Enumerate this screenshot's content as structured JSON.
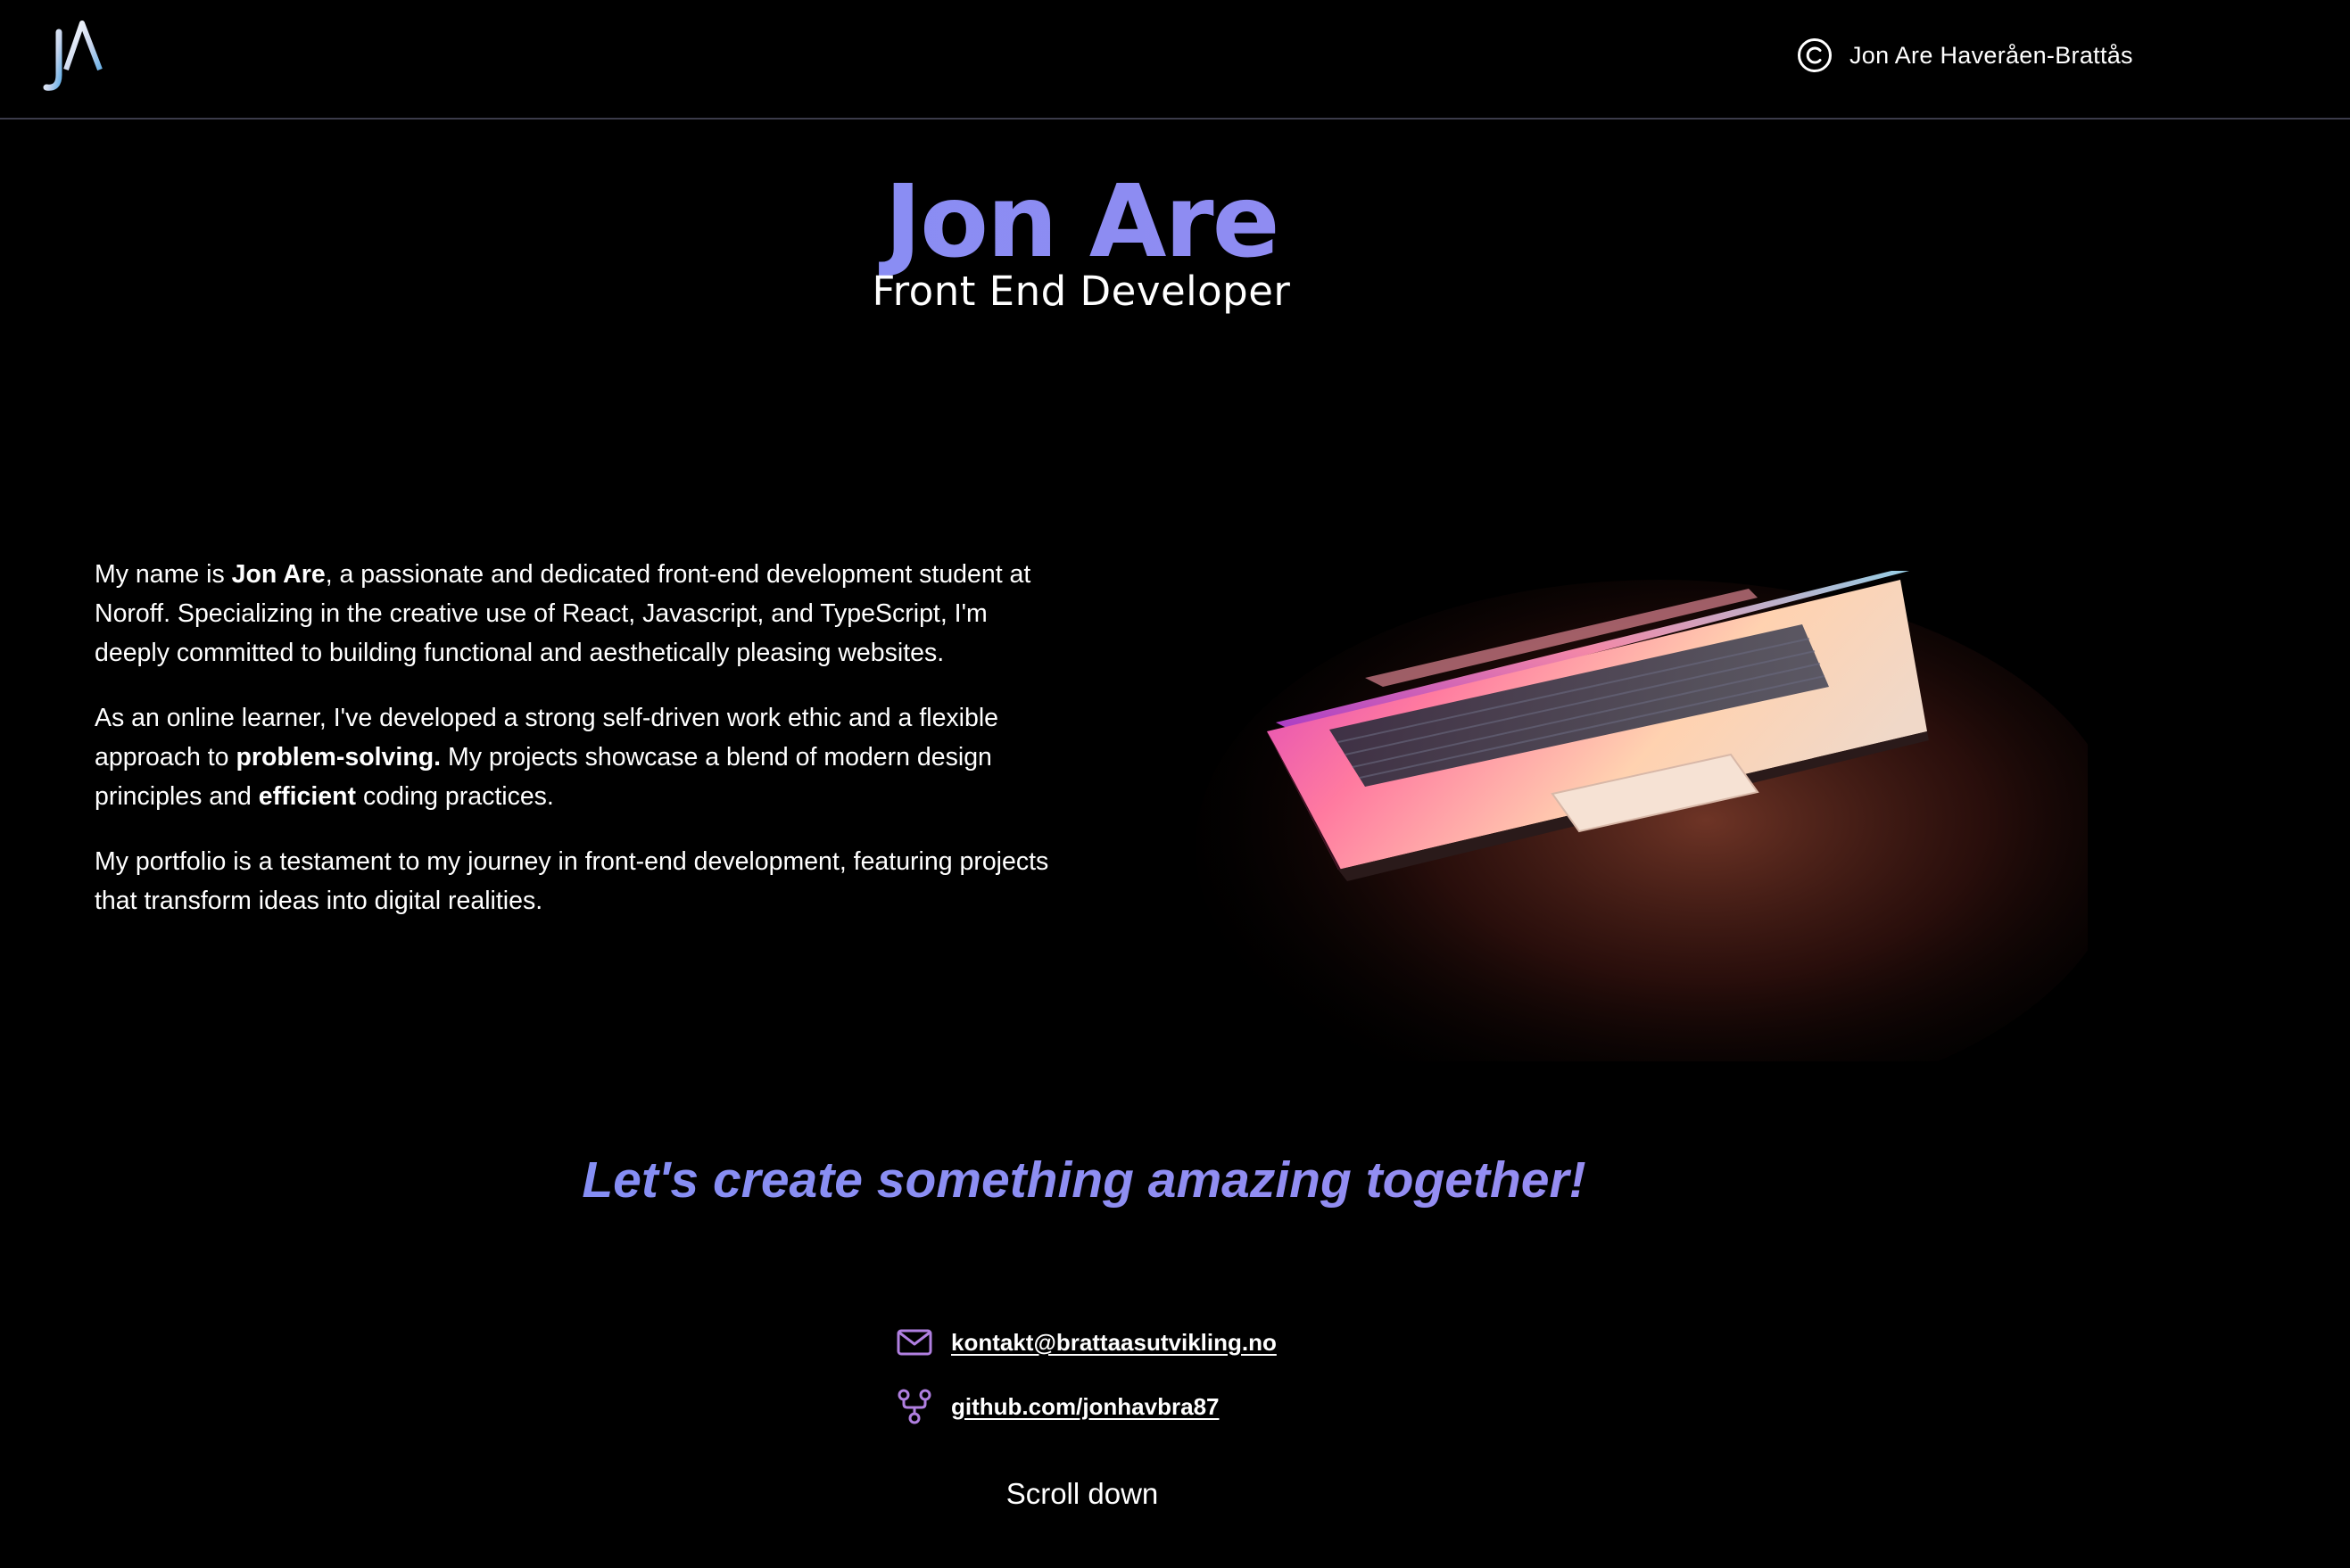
{
  "header": {
    "copyright_name": "Jon Are Haveråen-Brattås"
  },
  "hero": {
    "name": "Jon Are",
    "role": "Front End Developer"
  },
  "about": {
    "p1_intro": "My name is ",
    "p1_bold": "Jon Are",
    "p1_rest": ", a passionate and dedicated front-end development student at Noroff. Specializing in the creative use of React, Javascript, and TypeScript, I'm deeply committed to building functional and aesthetically pleasing websites.",
    "p2_intro": "As an online learner, I've developed a strong self-driven work ethic and a flexible approach to ",
    "p2_bold1": "problem-solving.",
    "p2_mid": " My projects showcase a blend of modern design principles and ",
    "p2_bold2": "efficient",
    "p2_end": " coding practices.",
    "p3": "My portfolio is a testament to my journey in front-end development, featuring projects that transform ideas into digital realities."
  },
  "tagline": "Let's create something amazing together!",
  "contacts": {
    "email": "kontakt@brattaasutvikling.no",
    "github": "github.com/jonhavbra87"
  },
  "scroll_label": "Scroll down",
  "colors": {
    "background": "#000000",
    "accent": "#8b8ff3",
    "icon_accent": "#b07fe0"
  },
  "icons": {
    "logo": "ja-monogram-logo",
    "copyright": "copyright-icon",
    "email": "mail-icon",
    "github": "git-fork-icon"
  }
}
